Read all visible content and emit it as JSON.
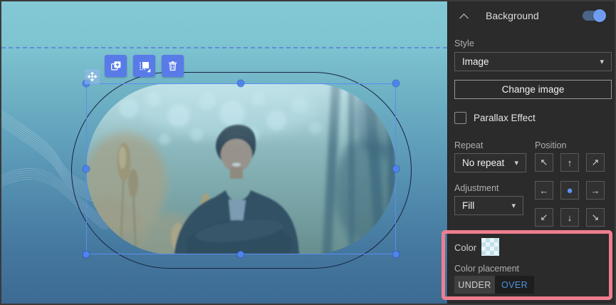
{
  "panel": {
    "title": "Background",
    "toggle_state": "on",
    "style_label": "Style",
    "style_value": "Image",
    "change_image_label": "Change image",
    "parallax_label": "Parallax Effect",
    "parallax_checked": false,
    "repeat_label": "Repeat",
    "repeat_value": "No repeat",
    "position_label": "Position",
    "position_selected": "center",
    "position_arrows": [
      "↖",
      "↑",
      "↗",
      "←",
      "●",
      "→",
      "↙",
      "↓",
      "↘"
    ],
    "adjustment_label": "Adjustment",
    "adjustment_value": "Fill",
    "color_label": "Color",
    "color_swatch": "transparent-checker",
    "color_placement_label": "Color placement",
    "placement_options": [
      "UNDER",
      "OVER"
    ],
    "placement_selected": "UNDER"
  },
  "icons": {
    "caret_down": "▾",
    "collapse": "chevron-up",
    "toolbar": [
      "move-icon",
      "duplicate-icon",
      "arrange-icon",
      "trash-icon"
    ]
  },
  "colors": {
    "accent_blue": "#587be8",
    "selection_blue": "#5d8df0",
    "toggle_knob": "#6e9cf1",
    "panel_bg": "#2b2b2b",
    "annotation_pink": "#ee7e8f",
    "canvas_top": "#83c9d5",
    "canvas_bottom": "#3c6a93",
    "shape_outline": "#17233e"
  }
}
